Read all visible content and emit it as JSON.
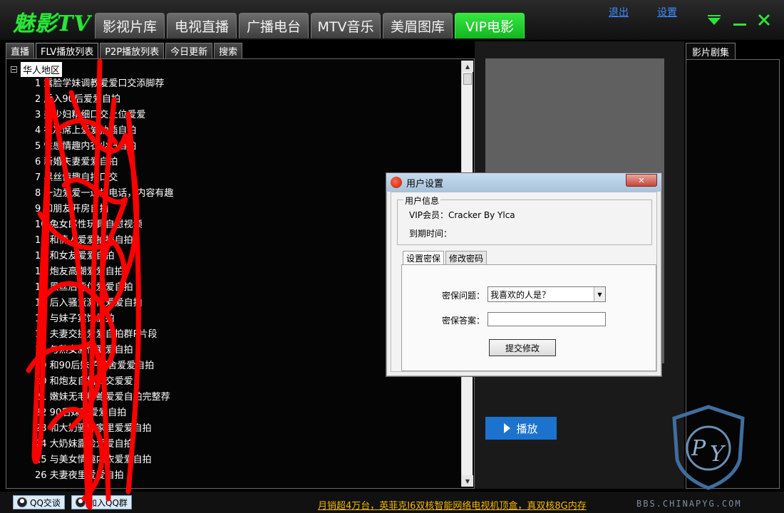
{
  "app": {
    "logo": "魅影TV"
  },
  "header": {
    "tabs": [
      {
        "label": "影视片库",
        "active": false
      },
      {
        "label": "电视直播",
        "active": false
      },
      {
        "label": "广播电台",
        "active": false
      },
      {
        "label": "MTV音乐",
        "active": false
      },
      {
        "label": "美眉图库",
        "active": false
      },
      {
        "label": "VIP电影",
        "active": true
      }
    ],
    "logout_label": "退出",
    "settings_label": "设置",
    "window_controls": [
      "chevron-down-icon",
      "minimize-icon",
      "close-icon"
    ]
  },
  "sub_tabs": [
    {
      "label": "直播",
      "active": false
    },
    {
      "label": "FLV播放列表",
      "active": true
    },
    {
      "label": "P2P播放列表",
      "active": false
    },
    {
      "label": "今日更新",
      "active": false
    },
    {
      "label": "搜索",
      "active": false
    }
  ],
  "tree": {
    "root_label": "华人地区",
    "items": [
      "1 露脸学妹调教爱爱口交添脚荐",
      "2 后入90后爱爱自拍",
      "3 美少妇精细口交上位爱爱",
      "4 在凉席上爱爱抽插自拍",
      "5 性感情趣内衣少妇自拍",
      "6 新婚夫妻爱爱自拍",
      "7 黑丝情趣自拍口交",
      "8 一边爱爱一边打电话，内容有趣",
      "9 和朋友开房自拍",
      "10 兔女郎性玩具自慰视频",
      "11 和情人爱爱抽插自拍",
      "12 和女友爱爱自拍",
      "13 炮友高潮爱爱自拍",
      "14 黑丝后背位爱爱自拍",
      "15 后入骚货激情爱爱自拍",
      "16 与妹子宾馆偷拍",
      "17 夫妻交换爱爱自拍群P片段",
      "18 与熟女激情爱爱自拍",
      "19 和90后妹子宿舍爱爱自拍",
      "20 和炮友自拍口交爱爱",
      "21 嫩妹无毛粉鲍爱爱自拍完整荐",
      "22 90后妹妻爱爱自拍",
      "23 和大奶骚妹家里爱爱自拍",
      "24 大奶妹露脸爱爱自拍",
      "25 与美女情趣内衣爱爱自拍",
      "26 夫妻夜里爱爱自拍"
    ]
  },
  "player": {
    "play_label": "播放"
  },
  "episodes": {
    "tab_label": "影片剧集"
  },
  "dialog": {
    "title": "用户设置",
    "group_title": "用户信息",
    "vip_text": "VIP会员：Cracker By Ylca",
    "expire_label": "到期时间：",
    "tabs": [
      {
        "label": "设置密保",
        "active": true
      },
      {
        "label": "修改密码",
        "active": false
      }
    ],
    "question_label": "密保问题：",
    "question_value": "我喜欢的人是？",
    "answer_label": "密保答案：",
    "answer_value": "",
    "submit_label": "提交修改"
  },
  "footer": {
    "qq_chat": "QQ交谈",
    "join_group": "加入QQ群",
    "ad": "月销超4万台，英菲克I6双核智能网络电视机顶盒，真双核8G内存",
    "watermark": "BBS.CHINAPYG.COM"
  },
  "colors": {
    "accent_green": "#2ee33a",
    "link_blue": "#3d8cff",
    "play_blue": "#1c73ce",
    "ad_yellow": "#f5b800",
    "scribble_red": "#ff0000"
  }
}
